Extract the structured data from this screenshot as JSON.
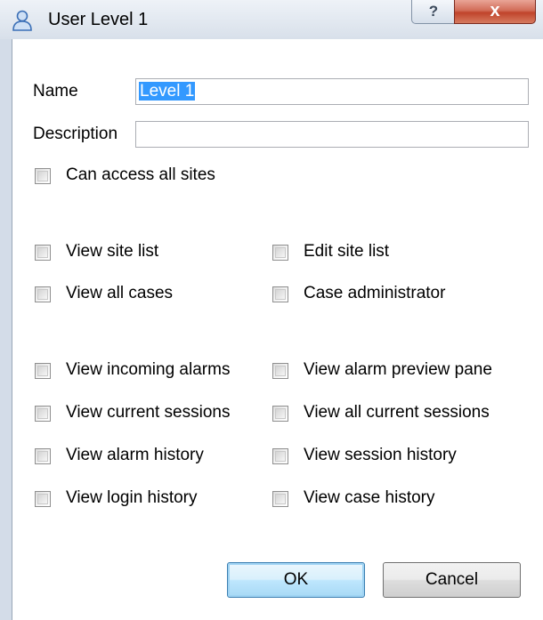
{
  "window": {
    "title": "User Level 1",
    "help_glyph": "?",
    "close_glyph": "x",
    "title_icon": "user-icon"
  },
  "form": {
    "name_label": "Name",
    "name_value": "Level 1",
    "description_label": "Description",
    "description_value": ""
  },
  "checkboxes": {
    "can_access_all_sites": {
      "label": "Can access all sites",
      "checked": false
    },
    "view_site_list": {
      "label": "View site list",
      "checked": false
    },
    "edit_site_list": {
      "label": "Edit site list",
      "checked": false
    },
    "view_all_cases": {
      "label": "View all cases",
      "checked": false
    },
    "case_administrator": {
      "label": "Case administrator",
      "checked": false
    },
    "view_incoming_alarms": {
      "label": "View incoming alarms",
      "checked": false
    },
    "view_alarm_preview_pane": {
      "label": "View alarm preview pane",
      "checked": false
    },
    "view_current_sessions": {
      "label": "View current sessions",
      "checked": false
    },
    "view_all_current_sessions": {
      "label": "View all current sessions",
      "checked": false
    },
    "view_alarm_history": {
      "label": "View alarm history",
      "checked": false
    },
    "view_session_history": {
      "label": "View session history",
      "checked": false
    },
    "view_login_history": {
      "label": "View login history",
      "checked": false
    },
    "view_case_history": {
      "label": "View case history",
      "checked": false
    }
  },
  "buttons": {
    "ok": "OK",
    "cancel": "Cancel"
  }
}
